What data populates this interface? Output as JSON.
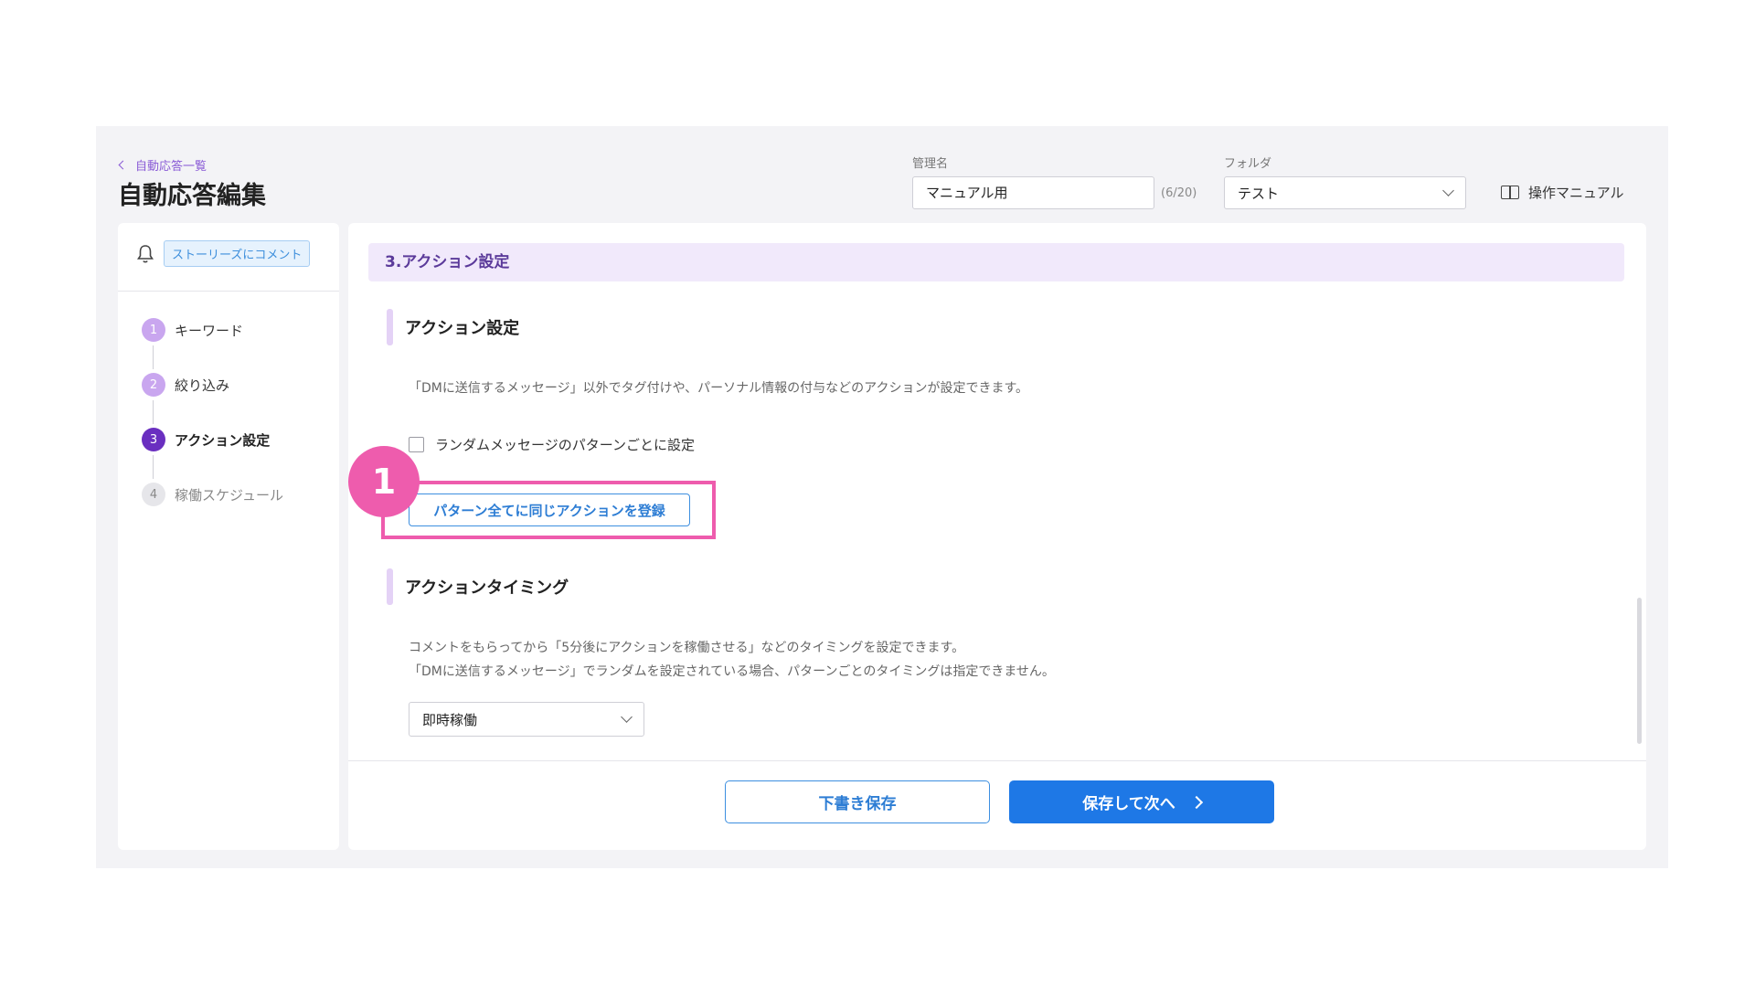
{
  "header": {
    "breadcrumb": "自動応答一覧",
    "title": "自動応答編集",
    "name_label": "管理名",
    "name_value": "マニュアル用",
    "name_counter": "(6/20)",
    "folder_label": "フォルダ",
    "folder_value": "テスト",
    "manual_link": "操作マニュアル"
  },
  "sidebar": {
    "trigger_badge": "ストーリーズにコメント",
    "steps": [
      {
        "num": "1",
        "label": "キーワード",
        "state": "done"
      },
      {
        "num": "2",
        "label": "絞り込み",
        "state": "done"
      },
      {
        "num": "3",
        "label": "アクション設定",
        "state": "active"
      },
      {
        "num": "4",
        "label": "稼働スケジュール",
        "state": "pending"
      }
    ]
  },
  "main": {
    "section_header": "3.アクション設定",
    "action": {
      "title": "アクション設定",
      "description": "「DMに送信するメッセージ」以外でタグ付けや、パーソナル情報の付与などのアクションが設定できます。",
      "checkbox_label": "ランダムメッセージのパターンごとに設定",
      "register_button": "パターン全てに同じアクションを登録"
    },
    "timing": {
      "title": "アクションタイミング",
      "description_1": "コメントをもらってから「5分後にアクションを稼働させる」などのタイミングを設定できます。",
      "description_2": "「DMに送信するメッセージ」でランダムを設定されている場合、パターンごとのタイミングは指定できません。",
      "selected": "即時稼働"
    },
    "annotation_marker": "1"
  },
  "footer": {
    "draft_button": "下書き保存",
    "next_button": "保存して次へ"
  },
  "colors": {
    "accent_purple": "#8a5bd6",
    "step_done": "#c9a6ef",
    "step_active": "#6a2fc0",
    "step_pending": "#e6e6ea",
    "primary_blue": "#1e78e6",
    "highlight_pink": "#ee5cad"
  }
}
